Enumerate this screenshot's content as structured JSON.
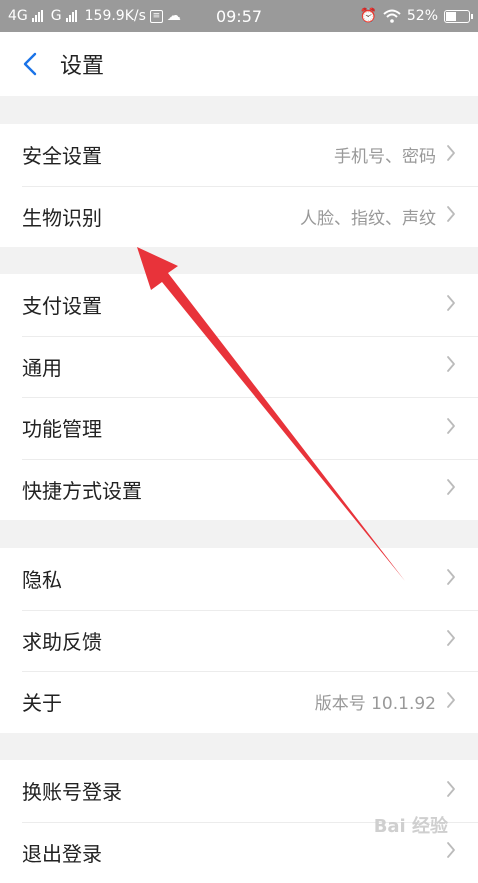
{
  "status_bar": {
    "network1": "4G",
    "network2": "G",
    "speed": "159.9K/s",
    "time": "09:57",
    "battery": "52%",
    "battery_level": 0.52
  },
  "nav": {
    "title": "设置"
  },
  "groups": [
    [
      {
        "label": "安全设置",
        "value": "手机号、密码"
      },
      {
        "label": "生物识别",
        "value": "人脸、指纹、声纹"
      }
    ],
    [
      {
        "label": "支付设置"
      },
      {
        "label": "通用"
      },
      {
        "label": "功能管理"
      },
      {
        "label": "快捷方式设置"
      }
    ],
    [
      {
        "label": "隐私"
      },
      {
        "label": "求助反馈"
      },
      {
        "label": "关于",
        "value": "版本号 10.1.92"
      }
    ],
    [
      {
        "label": "换账号登录"
      },
      {
        "label": "退出登录"
      }
    ]
  ],
  "colors": {
    "accent": "#1a73e8",
    "arrow": "#e8333a"
  },
  "watermark": "Bai 经验"
}
